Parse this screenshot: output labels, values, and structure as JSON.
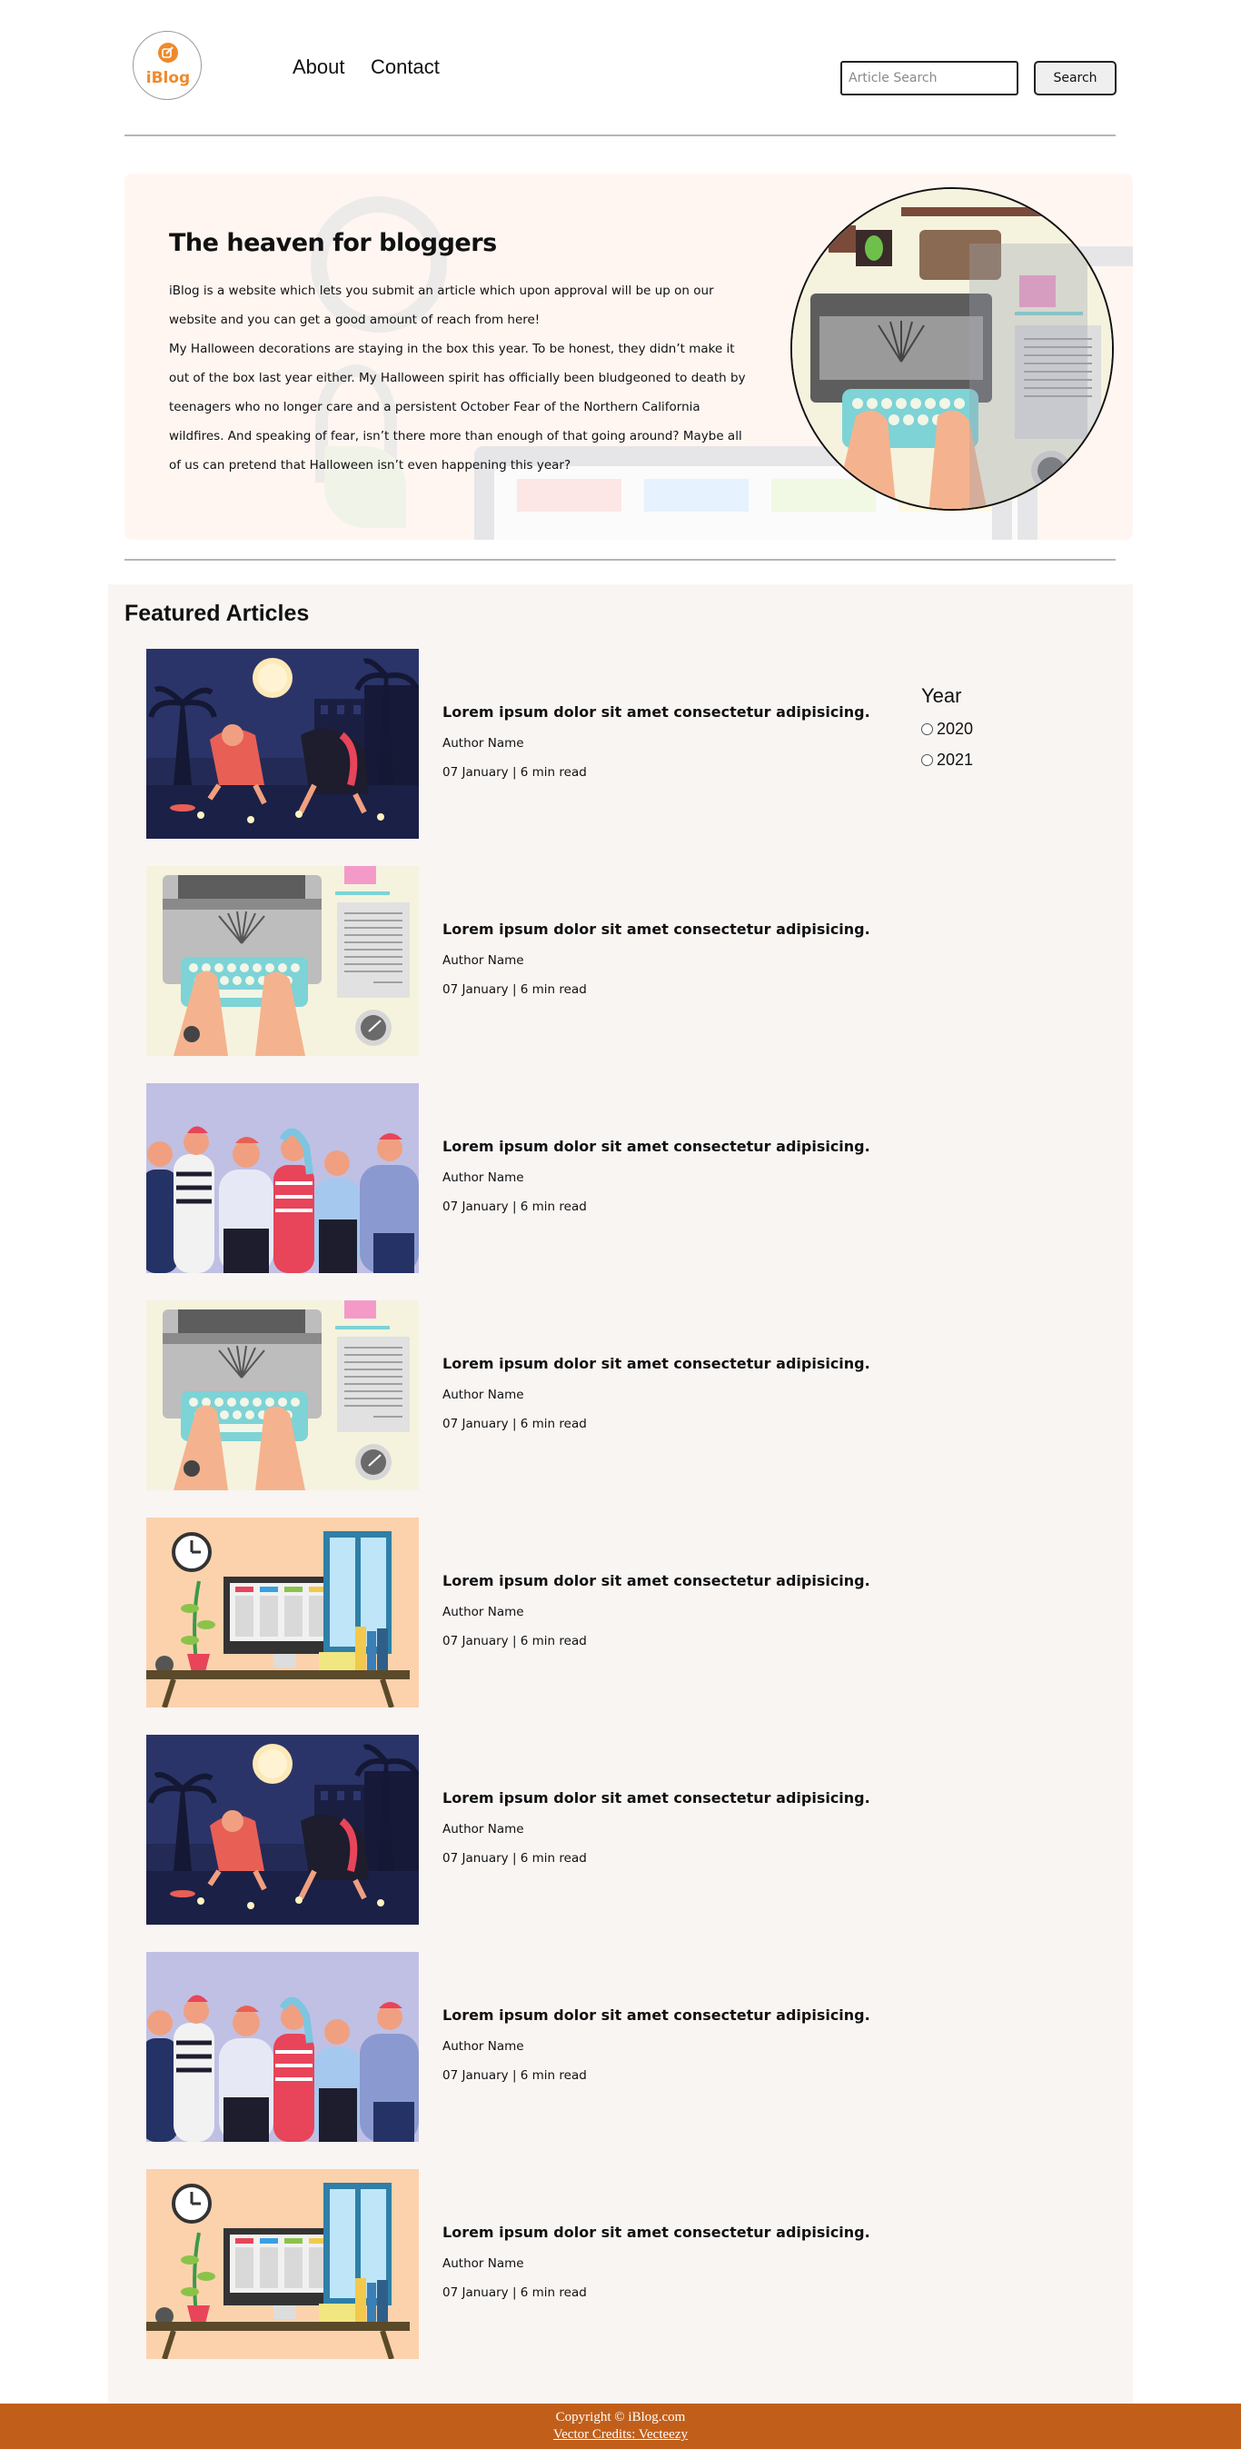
{
  "header": {
    "logo_text": "iBlog",
    "nav": [
      "About",
      "Contact"
    ],
    "search": {
      "placeholder": "Article Search",
      "value": "",
      "button": "Search"
    }
  },
  "hero": {
    "title": "The heaven for bloggers",
    "paragraph_1": "iBlog is a website which lets you submit an article which upon approval will be up on our website and you can get a good amount of reach from here!",
    "paragraph_2": "My Halloween decorations are staying in the box this year. To be honest, they didn’t make it out of the box last year either. My Halloween spirit has officially been bludgeoned to death by teenagers who no longer care and a persistent October Fear of the Northern California wildfires. And speaking of fear, isn’t there more than enough of that going around? Maybe all of us can pretend that Halloween isn’t even happening this year?"
  },
  "featured": {
    "title": "Featured Articles",
    "articles": [
      {
        "image": "night-scene",
        "title": "Lorem ipsum dolor sit amet consectetur adipisicing.",
        "author": "Author Name",
        "meta": "07 January | 6 min read"
      },
      {
        "image": "typewriter",
        "title": "Lorem ipsum dolor sit amet consectetur adipisicing.",
        "author": "Author Name",
        "meta": "07 January | 6 min read"
      },
      {
        "image": "crowd",
        "title": "Lorem ipsum dolor sit amet consectetur adipisicing.",
        "author": "Author Name",
        "meta": "07 January | 6 min read"
      },
      {
        "image": "typewriter",
        "title": "Lorem ipsum dolor sit amet consectetur adipisicing.",
        "author": "Author Name",
        "meta": "07 January | 6 min read"
      },
      {
        "image": "desk",
        "title": "Lorem ipsum dolor sit amet consectetur adipisicing.",
        "author": "Author Name",
        "meta": "07 January | 6 min read"
      },
      {
        "image": "night-scene",
        "title": "Lorem ipsum dolor sit amet consectetur adipisicing.",
        "author": "Author Name",
        "meta": "07 January | 6 min read"
      },
      {
        "image": "crowd",
        "title": "Lorem ipsum dolor sit amet consectetur adipisicing.",
        "author": "Author Name",
        "meta": "07 January | 6 min read"
      },
      {
        "image": "desk",
        "title": "Lorem ipsum dolor sit amet consectetur adipisicing.",
        "author": "Author Name",
        "meta": "07 January | 6 min read"
      }
    ]
  },
  "filter": {
    "title": "Year",
    "options": [
      "2020",
      "2021"
    ]
  },
  "footer": {
    "copyright": "Copyright © iBlog.com",
    "credit": "Vector Credits: Vecteezy"
  },
  "colors": {
    "brand_orange": "#ef8a2a",
    "footer_bg": "#c15f1a",
    "hero_bg": "#fff6f2",
    "featured_bg": "#f9f5f3"
  }
}
